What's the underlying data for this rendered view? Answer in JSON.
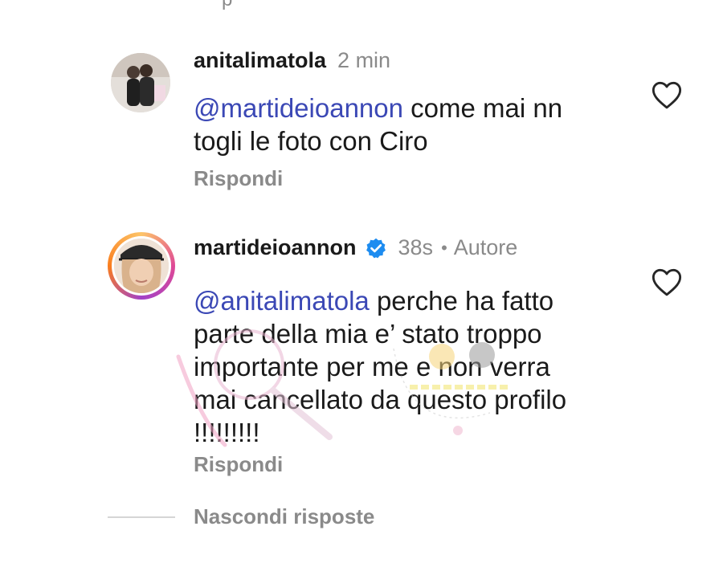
{
  "top_fragment": "p",
  "comments": [
    {
      "username": "anitalimatola",
      "time": "2 min",
      "mention": "@martideioannon",
      "text": "come mai nn togli le foto con Ciro",
      "reply_label": "Rispondi"
    },
    {
      "username": "martideioannon",
      "verified": true,
      "time": "38s",
      "separator": "•",
      "author_label": "Autore",
      "mention": "@anitalimatola",
      "text": "perche ha fatto parte della mia e’ stato troppo importante per me e non verra mai cancellato da questo profilo !!!!!!!!!",
      "reply_label": "Rispondi"
    }
  ],
  "hide_replies_label": "Nascondi risposte",
  "colors": {
    "mention": "#3b48b5",
    "muted": "#8a8a8a",
    "verified_badge": "#1d8cf0"
  },
  "icons": {
    "like": "heart-outline-icon",
    "verified": "verified-badge-icon"
  }
}
